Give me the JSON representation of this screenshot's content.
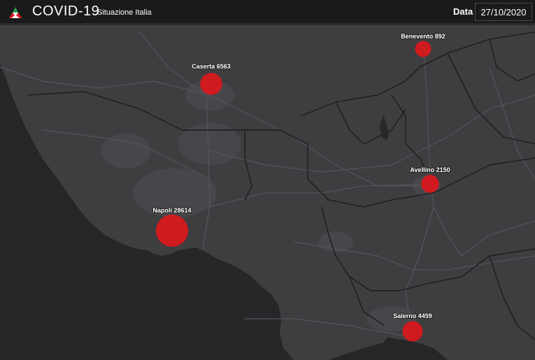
{
  "header": {
    "title": "COVID-19",
    "subtitle": "Situazione Italia",
    "date_label": "Data",
    "date_value": "27/10/2020"
  },
  "colors": {
    "marker": "#d7181c",
    "land": "#3d3d40",
    "sea": "#262629",
    "roads": "#505054",
    "boundaries": "#1f1f21"
  },
  "map": {
    "markers": [
      {
        "label": "Caserta 6563",
        "city": "Caserta",
        "cases": 6563
      },
      {
        "label": "Benevento 892",
        "city": "Benevento",
        "cases": 892
      },
      {
        "label": "Avellino 2150",
        "city": "Avellino",
        "cases": 2150
      },
      {
        "label": "Napoli 28614",
        "city": "Napoli",
        "cases": 28614
      },
      {
        "label": "Salerno 4459",
        "city": "Salerno",
        "cases": 4459
      }
    ]
  }
}
